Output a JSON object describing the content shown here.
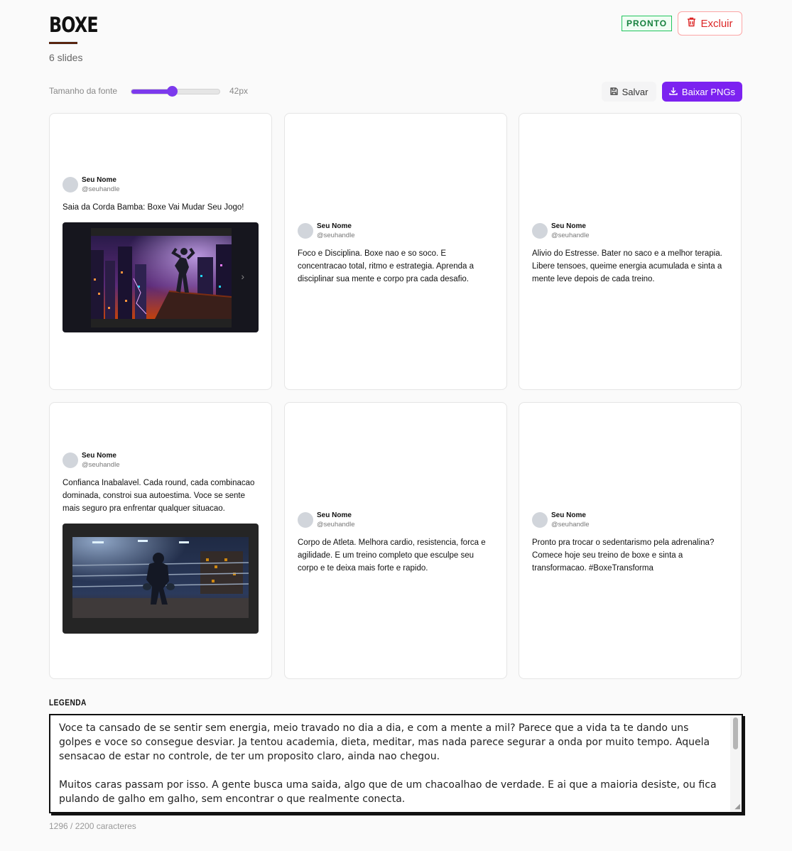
{
  "header": {
    "title": "BOXE",
    "slide_count": "6 slides"
  },
  "status_badge": "PRONTO",
  "delete_button": "Excluir",
  "toolbar": {
    "font_size_label": "Tamanho da fonte",
    "font_size_value": "42px",
    "slider_level": 0.46,
    "save_label": "Salvar",
    "download_label": "Baixar PNGs"
  },
  "slides": [
    {
      "name": "Seu Nome",
      "handle": "@seuhandle",
      "text": "Saia da Corda Bamba: Boxe Vai Mudar Seu Jogo!",
      "image": "boxer-rooftop-city-night"
    },
    {
      "name": "Seu Nome",
      "handle": "@seuhandle",
      "text": "Foco e Disciplina. Boxe nao e so soco. E concentracao total, ritmo e estrategia. Aprenda a disciplinar sua mente e corpo pra cada desafio."
    },
    {
      "name": "Seu Nome",
      "handle": "@seuhandle",
      "text": "Alivio do Estresse. Bater no saco e a melhor terapia. Libere tensoes, queime energia acumulada e sinta a mente leve depois de cada treino."
    },
    {
      "name": "Seu Nome",
      "handle": "@seuhandle",
      "text": "Confianca Inabalavel. Cada round, cada combinacao dominada, constroi sua autoestima. Voce se sente mais seguro pra enfrentar qualquer situacao.",
      "image": "boxer-sitting-in-ring"
    },
    {
      "name": "Seu Nome",
      "handle": "@seuhandle",
      "text": "Corpo de Atleta. Melhora cardio, resistencia, forca e agilidade. E um treino completo que esculpe seu corpo e te deixa mais forte e rapido."
    },
    {
      "name": "Seu Nome",
      "handle": "@seuhandle",
      "text": "Pronto pra trocar o sedentarismo pela adrenalina? Comece hoje seu treino de boxe e sinta a transformacao. #BoxeTransforma"
    }
  ],
  "caption": {
    "label": "LEGENDA",
    "text": "Voce ta cansado de se sentir sem energia, meio travado no dia a dia, e com a mente a mil? Parece que a vida ta te dando uns golpes e voce so consegue desviar. Ja tentou academia, dieta, meditar, mas nada parece segurar a onda por muito tempo. Aquela sensacao de estar no controle, de ter um proposito claro, ainda nao chegou.\n\nMuitos caras passam por isso. A gente busca uma saida, algo que de um chacoalhao de verdade. E ai que a maioria desiste, ou fica pulando de galho em galho, sem encontrar o que realmente conecta.",
    "char_count": "1296 / 2200 caracteres"
  },
  "colors": {
    "accent": "#7c22f0",
    "status": "#22c55e",
    "danger": "#dc2626"
  }
}
